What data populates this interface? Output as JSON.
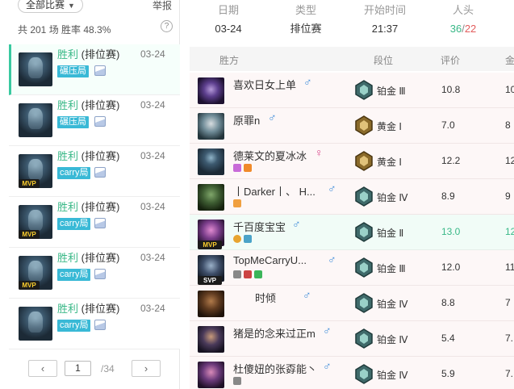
{
  "left": {
    "filter_label": "全部比赛",
    "report_label": "举报",
    "summary": "共 201 场   胜率 48.3%",
    "help": "?",
    "matches": [
      {
        "result": "胜利",
        "mode": "(排位赛)",
        "date": "03-24",
        "tag": "碾压局",
        "mvp": "",
        "active": true
      },
      {
        "result": "胜利",
        "mode": "(排位赛)",
        "date": "03-24",
        "tag": "碾压局",
        "mvp": ""
      },
      {
        "result": "胜利",
        "mode": "(排位赛)",
        "date": "03-24",
        "tag": "carry局",
        "mvp": "MVP"
      },
      {
        "result": "胜利",
        "mode": "(排位赛)",
        "date": "03-24",
        "tag": "carry局",
        "mvp": "MVP"
      },
      {
        "result": "胜利",
        "mode": "(排位赛)",
        "date": "03-24",
        "tag": "carry局",
        "mvp": "MVP"
      },
      {
        "result": "胜利",
        "mode": "(排位赛)",
        "date": "03-24",
        "tag": "carry局",
        "mvp": ""
      }
    ],
    "pager": {
      "prev": "‹",
      "page": "1",
      "total": "/34",
      "next": "›"
    }
  },
  "detail": {
    "date_label": "日期",
    "date_value": "03-24",
    "type_label": "类型",
    "type_value": "排位赛",
    "start_label": "开始时间",
    "start_value": "21:37",
    "kills_label": "人头",
    "kills_win": "36",
    "kills_sep": "/",
    "kills_lose": "22"
  },
  "table": {
    "headers": {
      "team": "胜方",
      "rank": "段位",
      "rating": "评价",
      "money": "金"
    },
    "rows": [
      {
        "name": "喜欢日女上单",
        "gender": "♂",
        "rank": "铂金 Ⅲ",
        "rating": "10.8",
        "money": "10",
        "mvp": ""
      },
      {
        "name": "原罪n",
        "gender": "♂",
        "rank": "黄金 Ⅰ",
        "rating": "7.0",
        "money": "8",
        "mvp": ""
      },
      {
        "name": "德莱文的夏冰冰",
        "gender": "♀",
        "rank": "黄金 Ⅰ",
        "rating": "12.2",
        "money": "12",
        "mvp": ""
      },
      {
        "name": "丨Darker丨、 H...",
        "gender": "♂",
        "rank": "铂金 Ⅳ",
        "rating": "8.9",
        "money": "9",
        "mvp": ""
      },
      {
        "name": "千百度宝宝",
        "gender": "♂",
        "rank": "铂金 Ⅱ",
        "rating": "13.0",
        "money": "12",
        "mvp": "MVP",
        "me": true
      },
      {
        "name": "TopMeCarryU...",
        "gender": "♂",
        "rank": "铂金 Ⅲ",
        "rating": "12.0",
        "money": "11",
        "mvp": "SVP"
      },
      {
        "name": "时倾",
        "gender": "♂",
        "rank": "铂金 Ⅳ",
        "rating": "8.8",
        "money": "7",
        "mvp": ""
      },
      {
        "name": "猪是的念来过正m",
        "gender": "♂",
        "rank": "铂金 Ⅳ",
        "rating": "5.4",
        "money": "7.",
        "mvp": ""
      },
      {
        "name": "杜傻妞的张孬能丶",
        "gender": "♂",
        "rank": "铂金 Ⅳ",
        "rating": "5.9",
        "money": "7.",
        "mvp": ""
      }
    ]
  },
  "colors": {
    "win_green": "#39b887",
    "lose_red": "#e25c5c",
    "accent": "#39c9a0",
    "tag_blue": "#39b9d6",
    "male_blue": "#3d8bd9",
    "female_pink": "#d9468a"
  }
}
